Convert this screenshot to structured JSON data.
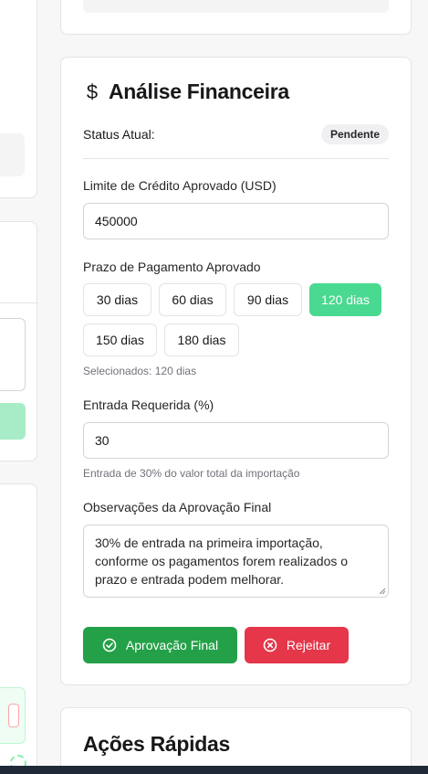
{
  "section": {
    "title": "Análise Financeira",
    "icon": "dollar-icon"
  },
  "status": {
    "label": "Status Atual:",
    "value": "Pendente"
  },
  "credit_limit": {
    "label": "Limite de Crédito Aprovado (USD)",
    "value": "450000"
  },
  "payment_term": {
    "label": "Prazo de Pagamento Aprovado",
    "options": [
      "30 dias",
      "60 dias",
      "90 dias",
      "120 dias",
      "150 dias",
      "180 dias"
    ],
    "selected": "120 dias",
    "selected_text": "Selecionados: 120 dias"
  },
  "down_payment": {
    "label": "Entrada Requerida (%)",
    "value": "30",
    "help": "Entrada de 30% do valor total da importação"
  },
  "notes": {
    "label": "Observações da Aprovação Final",
    "value": "30% de entrada na primeira importação, conforme os pagamentos forem realizados o prazo e entrada podem melhorar."
  },
  "actions": {
    "approve_label": "Aprovação Final",
    "reject_label": "Rejeitar"
  },
  "quick_actions": {
    "title": "Ações Rápidas"
  },
  "colors": {
    "selected_chip": "#4ad990",
    "approve": "#24a148",
    "reject": "#e5364a"
  }
}
